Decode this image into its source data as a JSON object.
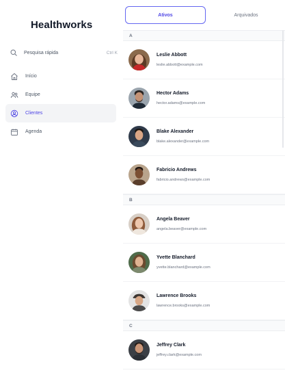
{
  "app": {
    "brand": "Healthworks"
  },
  "search": {
    "label": "Pesquisa rápida",
    "shortcut": "Ctrl K"
  },
  "nav": [
    {
      "label": "Início",
      "icon": "home-icon"
    },
    {
      "label": "Equipe",
      "icon": "users-icon"
    },
    {
      "label": "Clientes",
      "icon": "user-circle-icon",
      "active": true
    },
    {
      "label": "Agenda",
      "icon": "calendar-icon"
    }
  ],
  "tabs": {
    "active": "Ativos",
    "archived": "Arquivados"
  },
  "colors": {
    "accent": "#4f46e5",
    "accent_border": "#6366f1"
  },
  "sections": [
    {
      "letter": "A",
      "contacts": [
        {
          "name": "Leslie Abbott",
          "email": "leslie.abbott@example.com"
        },
        {
          "name": "Hector Adams",
          "email": "hector.adams@example.com"
        },
        {
          "name": "Blake Alexander",
          "email": "blake.alexander@example.com"
        },
        {
          "name": "Fabricio Andrews",
          "email": "fabricio.andrews@example.com"
        }
      ]
    },
    {
      "letter": "B",
      "contacts": [
        {
          "name": "Angela Beaver",
          "email": "angela.beaver@example.com"
        },
        {
          "name": "Yvette Blanchard",
          "email": "yvette.blanchard@example.com"
        },
        {
          "name": "Lawrence Brooks",
          "email": "lawrence.brooks@example.com"
        }
      ]
    },
    {
      "letter": "C",
      "contacts": [
        {
          "name": "Jeffrey Clark",
          "email": "jeffrey.clark@example.com"
        }
      ]
    }
  ]
}
